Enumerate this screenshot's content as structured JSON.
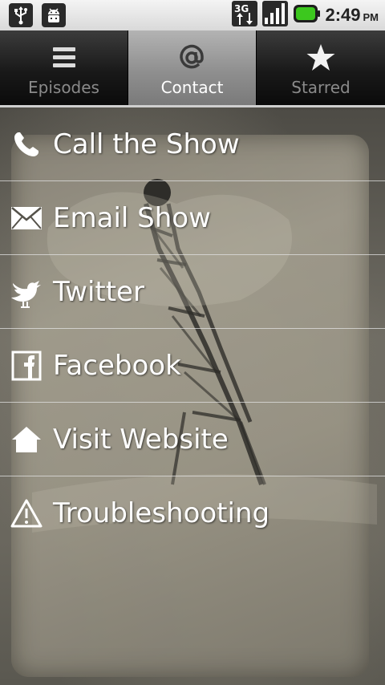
{
  "status_bar": {
    "time": "2:49",
    "ampm": "PM",
    "network": "3G",
    "battery_color": "#3cc81e"
  },
  "tabs": [
    {
      "label": "Episodes",
      "icon": "list-icon",
      "active": false
    },
    {
      "label": "Contact",
      "icon": "at-sign-icon",
      "active": true
    },
    {
      "label": "Starred",
      "icon": "star-icon",
      "active": false
    }
  ],
  "menu": [
    {
      "label": "Call the Show",
      "icon": "phone-icon"
    },
    {
      "label": "Email Show",
      "icon": "envelope-icon"
    },
    {
      "label": "Twitter",
      "icon": "bird-icon"
    },
    {
      "label": "Facebook",
      "icon": "facebook-icon"
    },
    {
      "label": "Visit Website",
      "icon": "home-icon"
    },
    {
      "label": "Troubleshooting",
      "icon": "warning-icon"
    }
  ]
}
